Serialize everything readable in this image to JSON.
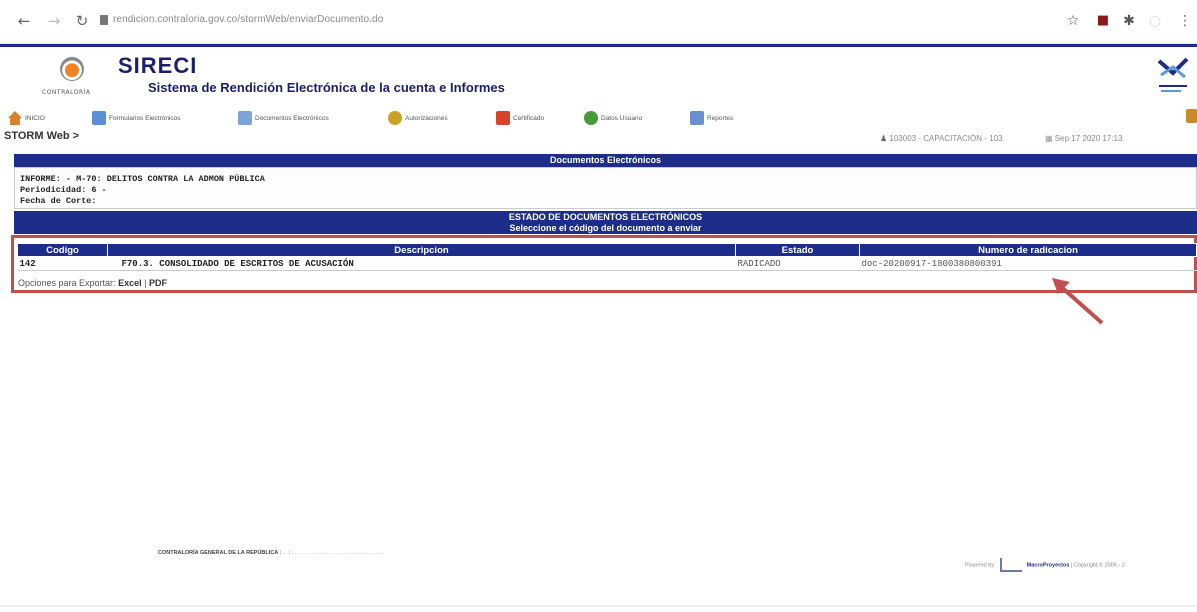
{
  "browser": {
    "url": "rendicion.contraloria.gov.co/stormWeb/enviarDocumento.do",
    "back_icon": "arrow-left-icon",
    "forward_icon": "arrow-right-icon",
    "reload_icon": "reload-icon"
  },
  "header": {
    "logo_text": "CONTRALORÍA",
    "title": "SIRECI",
    "subtitle": "Sistema de Rendición Electrónica de la cuenta e Informes"
  },
  "menu": {
    "items": [
      {
        "label": "INICIO",
        "icon": "home-icon",
        "color": "#d9822b"
      },
      {
        "label": "Formularios Electrónicos",
        "icon": "forms-icon",
        "color": "#5b8fd6"
      },
      {
        "label": "Documentos Electrónicos",
        "icon": "documents-icon",
        "color": "#7aa3d9"
      },
      {
        "label": "Autorizaciones",
        "icon": "keys-icon",
        "color": "#c9a227"
      },
      {
        "label": "Certificado",
        "icon": "certificate-icon",
        "color": "#d6452b"
      },
      {
        "label": "Datos Usuario",
        "icon": "user-data-icon",
        "color": "#4a9a3a"
      },
      {
        "label": "Reportes",
        "icon": "reports-icon",
        "color": "#6a8fd0"
      }
    ]
  },
  "breadcrumb": "STORM Web >",
  "session": {
    "user": "103003 - CAPACITACIÓN - 103",
    "date": "Sep 17 2020 17:13"
  },
  "documentos": {
    "section_title": "Documentos Electrónicos",
    "informe": "INFORME: - M-70: DELITOS CONTRA LA ADMON PÚBLICA",
    "periodicidad": "Periodicidad: 6 -",
    "fecha_corte": "Fecha de Corte:"
  },
  "estado": {
    "title": "ESTADO DE DOCUMENTOS ELECTRÓNICOS",
    "subtitle": "Seleccione el código del documento a enviar"
  },
  "table": {
    "headers": [
      "Codigo",
      "Descripcion",
      "Estado",
      "Numero de radicacion"
    ],
    "rows": [
      {
        "codigo": "142",
        "descripcion": "F70.3. CONSOLIDADO DE ESCRITOS DE ACUSACIÓN",
        "estado": "RADICADO",
        "radicacion": "doc-20200917-1800380800391"
      }
    ]
  },
  "export": {
    "label": "Opciones para Exportar:",
    "excel": "Excel",
    "separator": "|",
    "pdf": "PDF"
  },
  "footer": {
    "org": "CONTRALORÍA GENERAL DE LA REPÚBLICA",
    "powered": "Powered by:",
    "brand": "MacroProyectos",
    "copyright": "| Copyright © 2006 - 2"
  },
  "colors": {
    "navy": "#1e2c8a",
    "highlight": "#c0504d"
  }
}
